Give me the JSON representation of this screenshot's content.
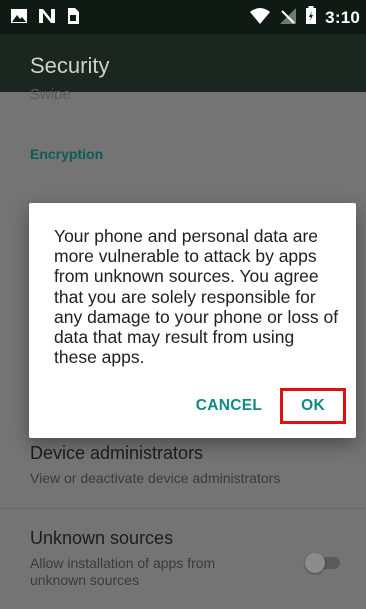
{
  "status_bar": {
    "time": "3:10",
    "icons": [
      "image-icon",
      "n-notification-icon",
      "sim-card-icon",
      "wifi-icon",
      "no-signal-icon",
      "battery-icon"
    ]
  },
  "app_bar": {
    "title": "Security"
  },
  "settings": {
    "partial_item": "Swipe",
    "section_header": "Encryption",
    "items": [
      {
        "title": "Device administrators",
        "summary": "View or deactivate device administrators"
      },
      {
        "title": "Unknown sources",
        "summary": "Allow installation of apps from unknown sources",
        "toggle": "off"
      }
    ]
  },
  "dialog": {
    "message": "Your phone and personal data are more vulnerable to attack by apps from unknown sources. You agree that you are solely responsible for any damage to your phone or loss of data that may result from using these apps.",
    "cancel_label": "CANCEL",
    "ok_label": "OK"
  },
  "colors": {
    "accent": "#0d8a84",
    "highlight": "#e01010",
    "status_bar": "#0f1a15",
    "app_bar": "#1b2620"
  }
}
